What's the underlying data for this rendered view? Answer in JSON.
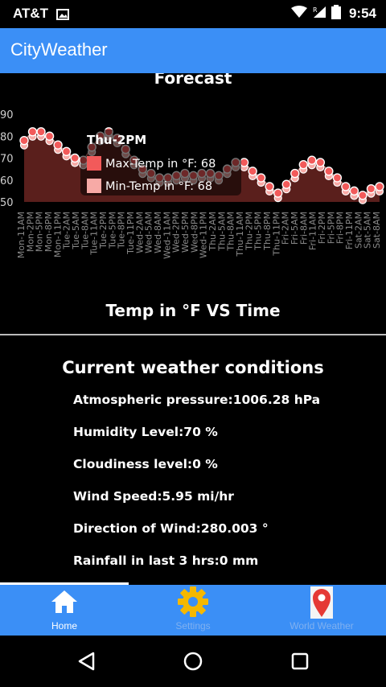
{
  "status": {
    "carrier": "AT&T",
    "time": "9:54"
  },
  "app": {
    "title": "CityWeather"
  },
  "forecast": {
    "title": "Forecast",
    "caption": "Temp in °F VS Time"
  },
  "tooltip": {
    "title": "Thu-2PM",
    "max_label": "Max-Temp in °F: 68",
    "min_label": "Min-Temp in °F: 68"
  },
  "conditions": {
    "title": "Current weather conditions",
    "pressure": "Atmospheric pressure:1006.28 hPa",
    "humidity": "Humidity Level:70 %",
    "cloudiness": "Cloudiness level:0 %",
    "wind_speed": "Wind Speed:5.95 mi/hr",
    "wind_direction": "Direction of Wind:280.003 °",
    "rainfall": "Rainfall in last 3 hrs:0 mm"
  },
  "nav": {
    "home": "Home",
    "settings": "Settings",
    "world": "World Weather"
  },
  "colors": {
    "accent": "#3b8ff6",
    "max_point": "#f25a5a",
    "min_point": "#f7aaa6",
    "area": "#5a1f1c"
  },
  "chart_data": {
    "type": "area",
    "title": "Forecast",
    "xlabel": "Temp in °F VS Time",
    "ylabel": "",
    "ylim": [
      50,
      90
    ],
    "yticks": [
      50,
      60,
      70,
      80,
      90
    ],
    "categories": [
      "Mon-11AM",
      "Mon-2PM",
      "Mon-5PM",
      "Mon-8PM",
      "Mon-11PM",
      "Tue-2AM",
      "Tue-5AM",
      "Tue-8AM",
      "Tue-11AM",
      "Tue-2PM",
      "Tue-5PM",
      "Tue-8PM",
      "Tue-11PM",
      "Wed-2AM",
      "Wed-5AM",
      "Wed-8AM",
      "Wed-11AM",
      "Wed-2PM",
      "Wed-5PM",
      "Wed-8PM",
      "Wed-11PM",
      "Thu-2AM",
      "Thu-5AM",
      "Thu-8AM",
      "Thu-11AM",
      "Thu-2PM",
      "Thu-5PM",
      "Thu-8PM",
      "Thu-11PM",
      "Fri-2AM",
      "Fri-5AM",
      "Fri-8AM",
      "Fri-11AM",
      "Fri-2PM",
      "Fri-5PM",
      "Fri-8PM",
      "Fri-11PM",
      "Sat-2AM",
      "Sat-5AM",
      "Sat-8AM"
    ],
    "series": [
      {
        "name": "Max-Temp in °F",
        "values": [
          78,
          82,
          82,
          80,
          76,
          73,
          70,
          69,
          75,
          80,
          82,
          79,
          74,
          69,
          65,
          63,
          61,
          61,
          62,
          63,
          62,
          63,
          63,
          62,
          65,
          68,
          68,
          64,
          61,
          57,
          54,
          58,
          63,
          67,
          69,
          68,
          64,
          61,
          57,
          55,
          53,
          56,
          57
        ]
      },
      {
        "name": "Min-Temp in °F",
        "values": [
          78,
          82,
          82,
          80,
          76,
          73,
          70,
          69,
          75,
          80,
          82,
          79,
          74,
          69,
          65,
          63,
          61,
          61,
          62,
          63,
          62,
          63,
          63,
          62,
          65,
          68,
          68,
          64,
          61,
          57,
          54,
          58,
          63,
          67,
          69,
          68,
          64,
          61,
          57,
          55,
          53,
          56,
          57
        ]
      }
    ],
    "grid": false,
    "legend": "tooltip"
  }
}
